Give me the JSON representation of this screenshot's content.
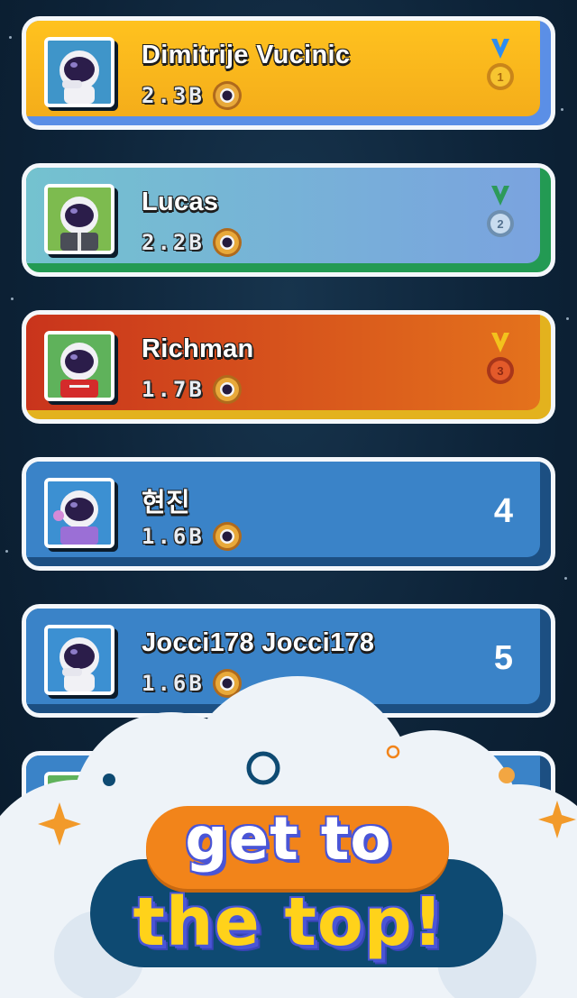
{
  "leaderboard": {
    "entries": [
      {
        "name": "Dimitrije Vucinic",
        "score": "2.3B",
        "rank_medal": "gold-medal-icon",
        "card_color": "#f6b81f"
      },
      {
        "name": "Lucas",
        "score": "2.2B",
        "rank_medal": "silver-medal-icon",
        "card_color": "#6fb0d4"
      },
      {
        "name": "Richman",
        "score": "1.7B",
        "rank_medal": "bronze-medal-icon",
        "card_color": "#d9531c"
      },
      {
        "name": "현진",
        "score": "1.6B",
        "rank": "4",
        "card_color": "#3a83c8"
      },
      {
        "name": "Jocci178 Jocci178",
        "score": "1.6B",
        "rank": "5",
        "card_color": "#3a83c8"
      }
    ],
    "currency_icon": "coin-icon"
  },
  "promo": {
    "line1": "get to",
    "line2": "the top!"
  },
  "colors": {
    "gold_card": "#f6b81f",
    "silver_card": "#6fb0d4",
    "bronze_card": "#d9531c",
    "default_card": "#3a83c8",
    "banner_orange": "#f2841a",
    "banner_navy": "#0e4a72",
    "promo_yellow": "#ffd21a"
  }
}
